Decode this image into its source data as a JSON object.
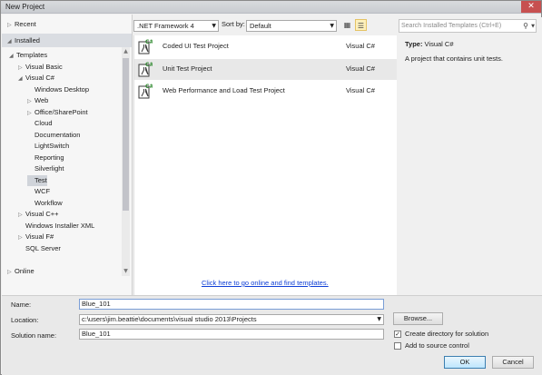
{
  "window": {
    "title": "New Project",
    "close_glyph": "✕"
  },
  "tree": {
    "recent_label": "Recent",
    "installed_label": "Installed",
    "online_label": "Online",
    "items": [
      {
        "label": "Templates",
        "arrow": "◢"
      },
      {
        "label": "Visual Basic",
        "arrow": "▷"
      },
      {
        "label": "Visual C#",
        "arrow": "◢"
      },
      {
        "label": "Windows Desktop",
        "arrow": ""
      },
      {
        "label": "Web",
        "arrow": "▷"
      },
      {
        "label": "Office/SharePoint",
        "arrow": "▷"
      },
      {
        "label": "Cloud",
        "arrow": ""
      },
      {
        "label": "Documentation",
        "arrow": ""
      },
      {
        "label": "LightSwitch",
        "arrow": ""
      },
      {
        "label": "Reporting",
        "arrow": ""
      },
      {
        "label": "Silverlight",
        "arrow": ""
      },
      {
        "label": "Test",
        "arrow": ""
      },
      {
        "label": "WCF",
        "arrow": ""
      },
      {
        "label": "Workflow",
        "arrow": ""
      },
      {
        "label": "Visual C++",
        "arrow": "▷"
      },
      {
        "label": "Windows Installer XML",
        "arrow": ""
      },
      {
        "label": "Visual F#",
        "arrow": "▷"
      },
      {
        "label": "SQL Server",
        "arrow": ""
      }
    ],
    "selected": "Test"
  },
  "toolbar": {
    "framework": ".NET Framework 4",
    "sort_by_label": "Sort by:",
    "sort_by_value": "Default"
  },
  "templates": [
    {
      "name": "Coded UI Test Project",
      "language": "Visual C#"
    },
    {
      "name": "Unit Test Project",
      "language": "Visual C#"
    },
    {
      "name": "Web Performance and Load Test Project",
      "language": "Visual C#"
    }
  ],
  "online_link": "Click here to go online and find templates.",
  "details": {
    "search_placeholder": "Search Installed Templates (Ctrl+E)",
    "type_label": "Type:",
    "type_value": "Visual C#",
    "description": "A project that contains unit tests."
  },
  "form": {
    "name_label": "Name:",
    "name_value": "Blue_101",
    "location_label": "Location:",
    "location_value": "c:\\users\\jim.beattie\\documents\\visual studio 2013\\Projects",
    "solution_label": "Solution name:",
    "solution_value": "Blue_101",
    "browse_label": "Browse...",
    "create_dir_label": "Create directory for solution",
    "create_dir_checked": true,
    "source_control_label": "Add to source control",
    "source_control_checked": false,
    "ok_label": "OK",
    "cancel_label": "Cancel"
  },
  "colors": {
    "link": "#0f3fd6",
    "selection": "#dadde2",
    "primary_button": "#bee6fd"
  }
}
